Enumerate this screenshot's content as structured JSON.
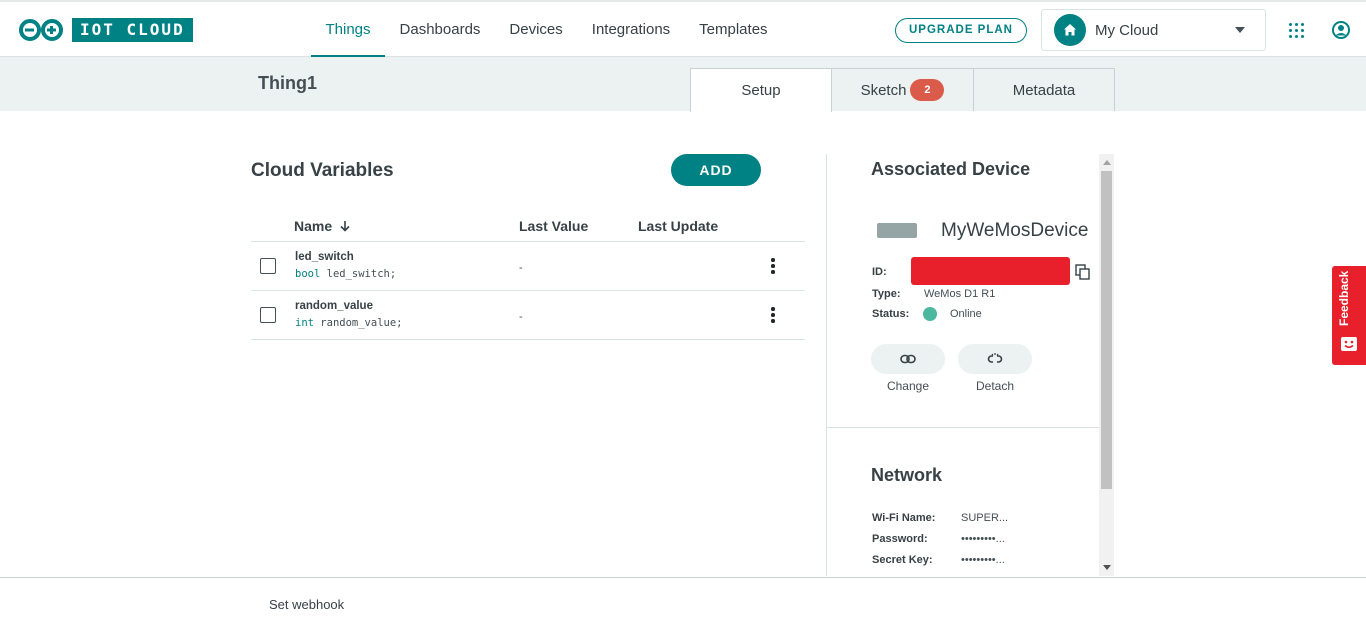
{
  "brand": {
    "logo_text": "IOT CLOUD",
    "accent": "#008184"
  },
  "nav": {
    "items": [
      "Things",
      "Dashboards",
      "Devices",
      "Integrations",
      "Templates"
    ],
    "active": "Things",
    "upgrade_label": "UPGRADE PLAN",
    "cloud_label": "My Cloud",
    "icons": [
      "home-icon",
      "chevron-down-icon",
      "apps-grid-icon",
      "user-account-icon"
    ]
  },
  "thing": {
    "title": "Thing1",
    "tabs": [
      {
        "label": "Setup",
        "active": true
      },
      {
        "label": "Sketch",
        "badge": "2"
      },
      {
        "label": "Metadata"
      }
    ]
  },
  "variables": {
    "title": "Cloud Variables",
    "add_label": "ADD",
    "columns": [
      "Name",
      "Last Value",
      "Last Update"
    ],
    "rows": [
      {
        "name": "led_switch",
        "type": "bool",
        "decl": "led_switch;",
        "last_value": "-"
      },
      {
        "name": "random_value",
        "type": "int",
        "decl": "random_value;",
        "last_value": "-"
      }
    ]
  },
  "device": {
    "title": "Associated Device",
    "name": "MyWeMosDevice",
    "id_label": "ID:",
    "type_label": "Type:",
    "type_value": "WeMos D1 R1",
    "status_label": "Status:",
    "status_value": "Online",
    "status_color": "#4db7a0",
    "change_label": "Change",
    "detach_label": "Detach"
  },
  "network": {
    "title": "Network",
    "wifi_label": "Wi-Fi Name:",
    "wifi_value": "SUPER...",
    "password_label": "Password:",
    "password_value": "•••••••••...",
    "secret_label": "Secret Key:",
    "secret_value": "•••••••••..."
  },
  "feedback_label": "Feedback",
  "footer": {
    "webhook_label": "Set webhook"
  }
}
